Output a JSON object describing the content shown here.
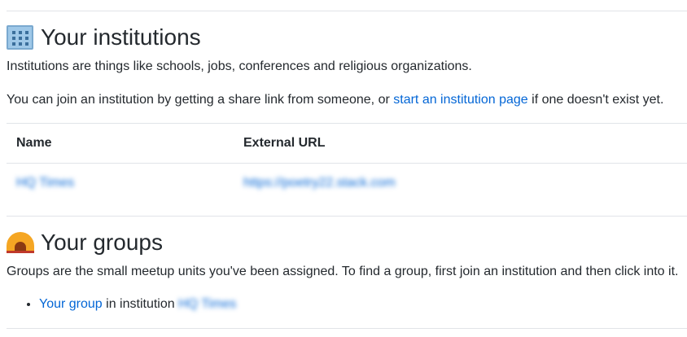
{
  "institutions": {
    "icon": "office-building-icon",
    "title": "Your institutions",
    "description": "Institutions are things like schools, jobs, conferences and religious organizations.",
    "join_prefix": "You can join an institution by getting a share link from someone, or ",
    "join_link": "start an institution page",
    "join_suffix": " if one doesn't exist yet.",
    "table": {
      "headers": [
        "Name",
        "External URL"
      ],
      "rows": [
        {
          "name": "HQ Times",
          "url": "https://poetry22.stack.com"
        }
      ]
    }
  },
  "groups": {
    "icon": "tent-icon",
    "title": "Your groups",
    "description": "Groups are the small meetup units you've been assigned. To find a group, first join an institution and then click into it.",
    "items": [
      {
        "link": "Your group",
        "middle": " in institution ",
        "institution": "HQ Times"
      }
    ]
  }
}
